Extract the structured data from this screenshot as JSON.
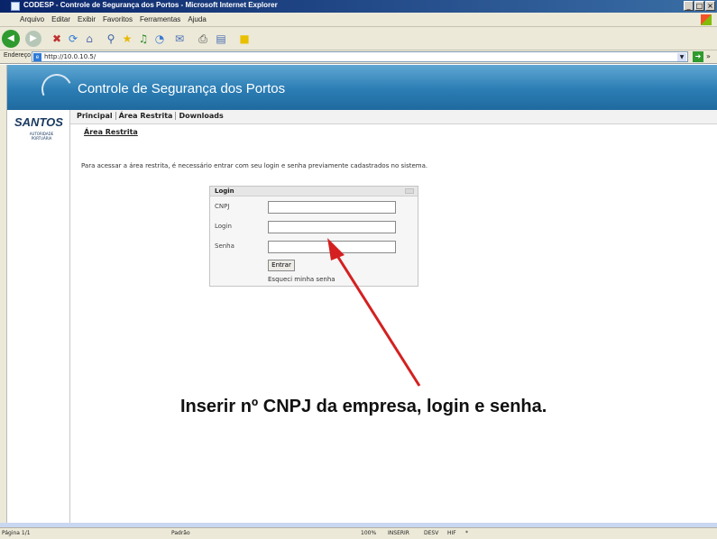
{
  "window": {
    "title": "CODESP - Controle de Segurança dos Portos - Microsoft Internet Explorer",
    "buttons": [
      "_",
      "□",
      "×"
    ]
  },
  "menu": {
    "items": [
      "Arquivo",
      "Editar",
      "Exibir",
      "Favoritos",
      "Ferramentas",
      "Ajuda"
    ]
  },
  "toolbar": {
    "icons": [
      "back-icon",
      "forward-icon",
      "stop-icon",
      "refresh-icon",
      "home-icon",
      "search-icon",
      "favorites-icon",
      "media-icon",
      "history-icon",
      "mail-icon",
      "print-icon",
      "edit-icon",
      "messenger-icon"
    ]
  },
  "address": {
    "label": "Endereço",
    "url": "http://10.0.10.5/"
  },
  "page": {
    "header_title": "Controle de Segurança dos Portos",
    "logo_text": "SANTOS",
    "logo_subtitle": "AUTORIDADE PORTUÁRIA",
    "nav": [
      "Principal",
      "Área Restrita",
      "Downloads"
    ],
    "section_title": "Área Restrita",
    "instructions": "Para acessar a área restrita, é necessário entrar com seu login e senha previamente cadastrados no sistema."
  },
  "login_form": {
    "title": "Login",
    "fields": {
      "cnpj_label": "CNPJ",
      "login_label": "Login",
      "senha_label": "Senha"
    },
    "values": {
      "cnpj": "",
      "login": "",
      "senha": ""
    },
    "submit": "Entrar",
    "forgot": "Esqueci minha senha"
  },
  "annotation": {
    "text": "Inserir nº CNPJ da empresa, login e senha.",
    "arrow_color": "#d42020"
  },
  "status": {
    "page": "Página 1/1",
    "style": "Padrão",
    "zoom": "100%",
    "insert": "INSERIR",
    "desv": "DESV",
    "hif": "HIF",
    "star": "*"
  }
}
